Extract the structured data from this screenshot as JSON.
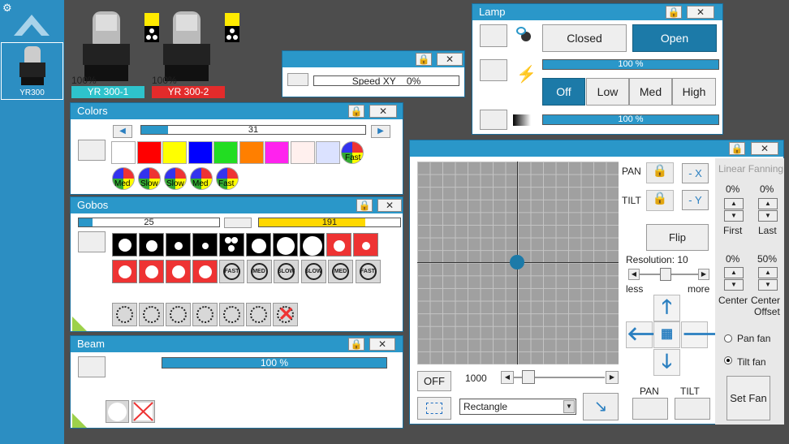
{
  "fixtures": [
    {
      "intensity": "100%",
      "name": "YR 300-1",
      "name_color": "#2ec3cc"
    },
    {
      "intensity": "100%",
      "name": "YR 300-2",
      "name_color": "#e32b2b"
    }
  ],
  "sidebar": {
    "thumb_label": "YR300"
  },
  "speed": {
    "label": "Speed XY",
    "value": "0%"
  },
  "lamp": {
    "title": "Lamp",
    "closed": "Closed",
    "open": "Open",
    "dimmer": "100 %",
    "off": "Off",
    "low": "Low",
    "med": "Med",
    "high": "High",
    "strobe": "100 %"
  },
  "colors": {
    "title": "Colors",
    "slider_value": "31",
    "swatches": [
      "#ffffff",
      "#ff0000",
      "#ffff00",
      "#0000ff",
      "#22dd22",
      "#ff7f00",
      "#ff22ee",
      "#fff0ee",
      "#dbe2ff"
    ],
    "wheel_labels": [
      "Fast",
      "Med",
      "Slow",
      "Slow",
      "Med",
      "Fast"
    ]
  },
  "gobos": {
    "title": "Gobos",
    "slider1": "25",
    "slider2": "191",
    "fx_labels": [
      "FAST",
      "MED",
      "SLOW",
      "SLOW",
      "MED",
      "FAST"
    ]
  },
  "beam": {
    "title": "Beam",
    "value": "100 %"
  },
  "pantilt": {
    "pan": "PAN",
    "tilt": "TILT",
    "neg_x": "- X",
    "neg_y": "- Y",
    "flip": "Flip",
    "resolution": "Resolution: 10",
    "less": "less",
    "more": "more",
    "off": "OFF",
    "size": "1000",
    "shape": "Rectangle",
    "pan_btn": "PAN",
    "tilt_btn": "TILT"
  },
  "fanning": {
    "title": "Linear Fanning",
    "first_val": "0%",
    "last_val": "0%",
    "first": "First",
    "last": "Last",
    "center_val": "0%",
    "offset_val": "50%",
    "center": "Center",
    "center_offset_1": "Center",
    "center_offset_2": "Offset",
    "pan_fan": "Pan fan",
    "tilt_fan": "Tilt fan",
    "set_fan": "Set Fan"
  },
  "colors_accent": {
    "primary": "#2a97c9",
    "active_button": "#1c7aa8",
    "gobo_slider": "#ffd800"
  }
}
